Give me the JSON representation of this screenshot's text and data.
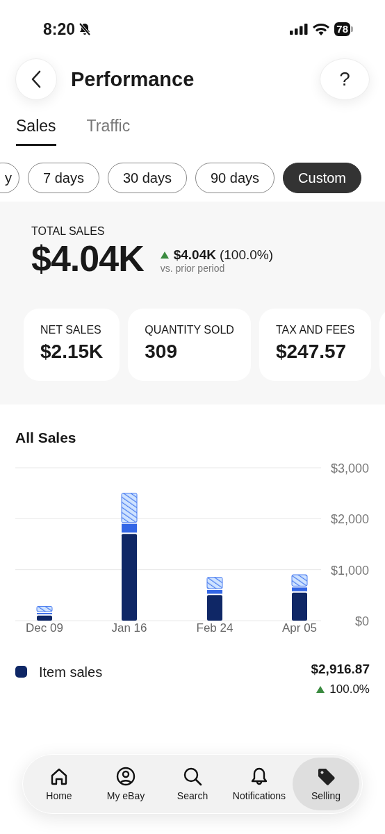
{
  "status_bar": {
    "time": "8:20",
    "battery": "78"
  },
  "header": {
    "title": "Performance",
    "help": "?"
  },
  "tabs": [
    {
      "label": "Sales",
      "selected": true
    },
    {
      "label": "Traffic",
      "selected": false
    }
  ],
  "ranges": [
    {
      "label": "y",
      "selected": false
    },
    {
      "label": "7 days",
      "selected": false
    },
    {
      "label": "30 days",
      "selected": false
    },
    {
      "label": "90 days",
      "selected": false
    },
    {
      "label": "Custom",
      "selected": true
    }
  ],
  "total": {
    "label": "TOTAL SALES",
    "value": "$4.04K",
    "change": "$4.04K",
    "change_pct": "(100.0%)",
    "comparison": "vs. prior period"
  },
  "metrics": [
    {
      "label": "NET SALES",
      "value": "$2.15K"
    },
    {
      "label": "QUANTITY SOLD",
      "value": "309"
    },
    {
      "label": "TAX AND FEES",
      "value": "$247.57"
    }
  ],
  "all_sales": {
    "title": "All Sales",
    "chart_data": {
      "type": "bar",
      "stacked": true,
      "categories": [
        "Dec 09",
        "Jan 16",
        "Feb 24",
        "Apr 05"
      ],
      "ylim": [
        0,
        3000
      ],
      "yticks": [
        {
          "value": 0,
          "label": "$0"
        },
        {
          "value": 1000,
          "label": "$1,000"
        },
        {
          "value": 2000,
          "label": "$2,000"
        },
        {
          "value": 3000,
          "label": "$3,000"
        }
      ],
      "series": [
        {
          "color": "#0f2766",
          "values": [
            100,
            1700,
            500,
            550
          ]
        },
        {
          "color": "#3366e6",
          "values": [
            50,
            200,
            100,
            100
          ]
        },
        {
          "color": "#cfe3ff",
          "values": [
            130,
            600,
            250,
            250
          ]
        }
      ]
    },
    "legend": [
      {
        "label": "Item sales",
        "color": "#0f2766",
        "value": "$2,916.87",
        "change": "100.0%"
      }
    ]
  },
  "nav": [
    {
      "label": "Home",
      "selected": false
    },
    {
      "label": "My eBay",
      "selected": false
    },
    {
      "label": "Search",
      "selected": false
    },
    {
      "label": "Notifications",
      "selected": false
    },
    {
      "label": "Selling",
      "selected": true
    }
  ]
}
